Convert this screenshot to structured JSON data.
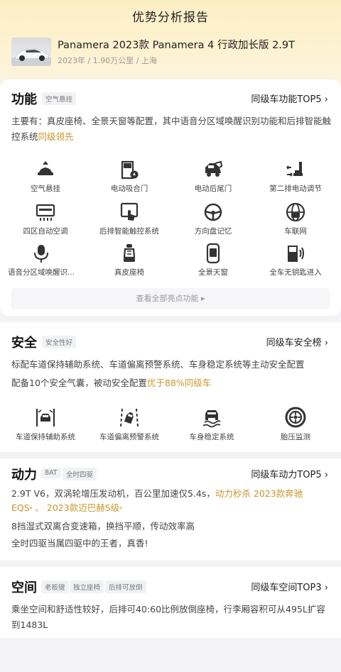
{
  "page_title": "优势分析报告",
  "car": {
    "name": "Panamera 2023款 Panamera 4 行政加长版 2.9T",
    "year": "2023年",
    "mileage": "1.90万公里",
    "city": "上海"
  },
  "function": {
    "title": "功能",
    "tag": "空气悬挂",
    "link": "同级车功能TOP5",
    "desc_prefix": "主要有：真皮座椅、全景天窗等配置，其中语音分区域唤醒识别功能和后排智能触控系统",
    "desc_highlight": "同级领先",
    "features": [
      {
        "label": "空气悬挂",
        "icon": "air-suspension-icon"
      },
      {
        "label": "电动吸合门",
        "icon": "soft-close-door-icon"
      },
      {
        "label": "电动后尾门",
        "icon": "power-tailgate-icon"
      },
      {
        "label": "第二排电动调节",
        "icon": "power-seat-icon"
      },
      {
        "label": "四区自动空调",
        "icon": "climate-control-icon"
      },
      {
        "label": "后排智能触控系统",
        "icon": "touch-panel-icon"
      },
      {
        "label": "方向盘记忆",
        "icon": "steering-wheel-icon"
      },
      {
        "label": "车联网",
        "icon": "connected-car-icon"
      },
      {
        "label": "语音分区域唤醒识...",
        "icon": "microphone-icon"
      },
      {
        "label": "真皮座椅",
        "icon": "leather-seat-icon"
      },
      {
        "label": "全景天窗",
        "icon": "panoramic-roof-icon"
      },
      {
        "label": "全车无钥匙进入",
        "icon": "keyless-entry-icon"
      }
    ],
    "view_all": "查看全部亮点功能"
  },
  "safety": {
    "title": "安全",
    "tag": "安全性好",
    "link": "同级车安全榜",
    "desc_line1": "标配车道保持辅助系统、车道偏离预警系统、车身稳定系统等主动安全配置",
    "desc_line2_prefix": "配备10个安全气囊，被动安全配置",
    "desc_line2_highlight": "优于88%同级车",
    "features": [
      {
        "label": "车道保持辅助系统",
        "icon": "lane-keep-icon"
      },
      {
        "label": "车道偏离预警系统",
        "icon": "lane-departure-icon"
      },
      {
        "label": "车身稳定系统",
        "icon": "stability-control-icon"
      },
      {
        "label": "胎压监测",
        "icon": "tire-pressure-icon"
      }
    ]
  },
  "power": {
    "title": "动力",
    "tags": [
      "8AT",
      "全时四驱"
    ],
    "link": "同级车动力TOP5",
    "line1_prefix": "2.9T V6，双涡轮增压发动机，百公里加速仅5.4s，",
    "line1_highlight": "动力秒杀 2023款奔驰",
    "line1_model1": "EQS",
    "line1_sep": "、",
    "line1_model2": "2023款迈巴赫S级",
    "line2": "8挡湿式双离合变速箱，换挡平顺，传动效率高",
    "line3": "全时四驱当属四驱中的王者，真香!"
  },
  "space": {
    "title": "空间",
    "tags": [
      "老板键",
      "独立座椅",
      "后排可放倒"
    ],
    "link": "同级车空间TOP3",
    "desc": "乘坐空间和舒适性较好，后排可40:60比例放倒座椅，行李厢容积可从495L扩容到1483L"
  },
  "colors": {
    "highlight": "#c9962c",
    "hero_bg": "#fdefc4",
    "icon": "#333333"
  }
}
